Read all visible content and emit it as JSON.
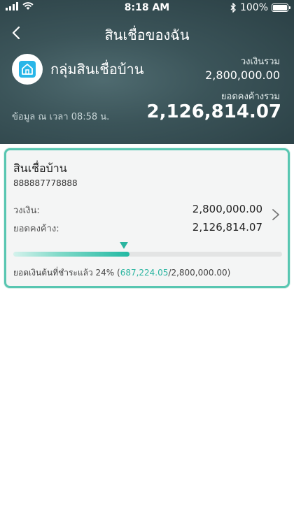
{
  "status_bar": {
    "time": "8:18 AM",
    "battery": "100%"
  },
  "header": {
    "title": "สินเชื่อของฉัน",
    "group_name": "กลุ่มสินเชื่อบ้าน",
    "limit_caption": "วงเงินรวม",
    "limit_value": "2,800,000.00",
    "outstanding_caption": "ยอดคงค้างรวม",
    "outstanding_value": "2,126,814.07",
    "timestamp": "ข้อมูล ณ เวลา 08:58 น."
  },
  "loan": {
    "title": "สินเชื่อบ้าน",
    "account_number": "888887778888",
    "limit_label": "วงเงิน:",
    "limit_value": "2,800,000.00",
    "outstanding_label": "ยอดคงค้าง:",
    "outstanding_value": "2,126,814.07",
    "progress_percent": 24,
    "progress_prefix": "ยอดเงินต้นที่ชำระแล้ว 24% (",
    "paid_amount": "687,224.05",
    "progress_suffix": "/2,800,000.00)"
  },
  "colors": {
    "header_bg": "#3b5459",
    "accent": "#2ab5a0",
    "card_border": "#58c6b1"
  },
  "icons": {
    "back": "chevron-left-icon",
    "group": "home-icon",
    "detail": "chevron-right-icon"
  }
}
